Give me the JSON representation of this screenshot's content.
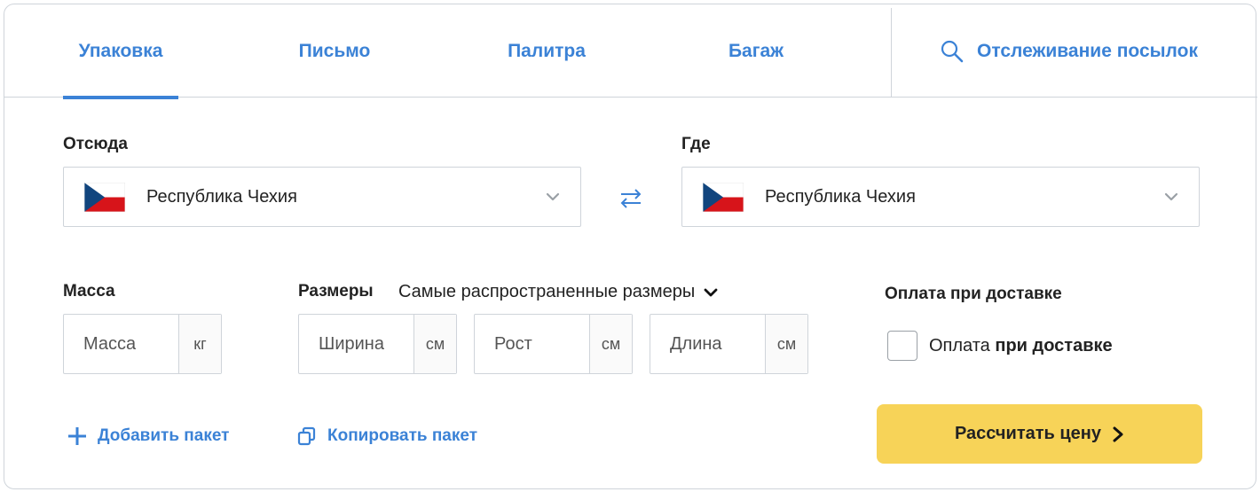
{
  "tabs": [
    {
      "label": "Упаковка",
      "active": true
    },
    {
      "label": "Письмо",
      "active": false
    },
    {
      "label": "Палитра",
      "active": false
    },
    {
      "label": "Багаж",
      "active": false
    }
  ],
  "tracking": {
    "label": "Отслеживание посылок",
    "icon": "search-icon"
  },
  "from": {
    "label": "Отсюда",
    "value": "Республика Чехия",
    "flag": "czech-flag"
  },
  "to": {
    "label": "Где",
    "value": "Республика Чехия",
    "flag": "czech-flag"
  },
  "mass": {
    "label": "Масса",
    "placeholder": "Масса",
    "unit": "кг"
  },
  "sizes": {
    "label": "Размеры",
    "dropdown": "Самые распространенные размеры",
    "width": {
      "placeholder": "Ширина",
      "unit": "см"
    },
    "height": {
      "placeholder": "Рост",
      "unit": "см"
    },
    "length": {
      "placeholder": "Длина",
      "unit": "см"
    }
  },
  "cod": {
    "heading": "Оплата при доставке",
    "text_plain": "Оплата ",
    "text_bold": "при доставке",
    "checked": false
  },
  "actions": {
    "add_package": "Добавить пакет",
    "copy_package": "Копировать пакет",
    "calculate": "Рассчитать цену"
  },
  "colors": {
    "accent": "#3b82d6",
    "button": "#f7d358",
    "border": "#cfd4da"
  }
}
